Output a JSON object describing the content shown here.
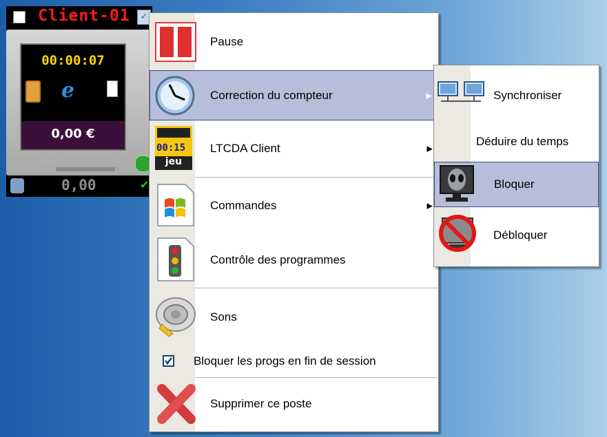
{
  "client_tile": {
    "name": "Client-01",
    "timer": "00:00:07",
    "price": "0,00 €",
    "footer_value": "0,00"
  },
  "context_menu": {
    "items": [
      {
        "label": "Pause",
        "icon": "pause-icon"
      },
      {
        "label": "Correction du compteur",
        "icon": "clock-icon",
        "has_submenu": true,
        "highlighted": true
      },
      {
        "label": "LTCDA Client",
        "icon": "ltcda-jeu-icon",
        "has_submenu": true,
        "icon_text_top": "00:15",
        "icon_text_bottom": "jeu"
      },
      {
        "label": "Commandes",
        "icon": "windows-doc-icon",
        "has_submenu": true
      },
      {
        "label": "Contrôle des programmes",
        "icon": "traffic-light-icon"
      },
      {
        "label": "Sons",
        "icon": "speaker-icon"
      },
      {
        "label": "Bloquer les progs en fin de session",
        "icon": "checkbox-icon",
        "checked": true
      },
      {
        "label": "Supprimer ce poste",
        "icon": "red-x-icon"
      }
    ]
  },
  "submenu": {
    "items": [
      {
        "label": "Synchroniser",
        "icon": "network-computers-icon"
      },
      {
        "label": "Déduire du temps"
      },
      {
        "label": "Bloquer",
        "icon": "alien-monitor-icon",
        "highlighted": true
      },
      {
        "label": "Débloquer",
        "icon": "no-entry-monitor-icon"
      }
    ]
  },
  "colors": {
    "highlight_bg": "#b6bfd9",
    "highlight_border": "#3b4d82",
    "client_name": "#ff1a1a",
    "timer": "#ffd400"
  }
}
